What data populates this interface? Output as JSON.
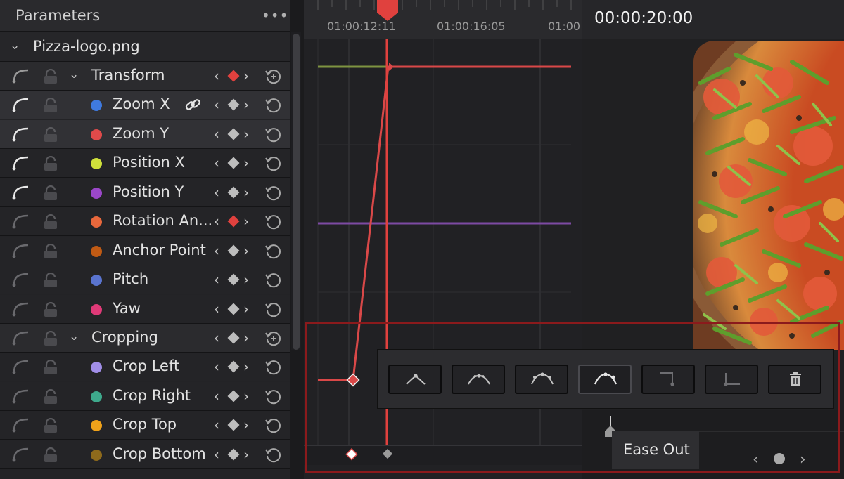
{
  "parameters_panel": {
    "title": "Parameters",
    "more_icon": "•••",
    "clip": {
      "name": "Pizza-logo.png"
    },
    "groups": [
      {
        "name": "Transform",
        "keyframe_color": "#e0413e",
        "rows": [
          {
            "label": "Zoom X",
            "dot": "#3f7ae0",
            "kf": "#bdbdbd",
            "link_icon": true,
            "selected": true
          },
          {
            "label": "Zoom Y",
            "dot": "#e04a4a",
            "kf": "#bdbdbd",
            "selected": true
          },
          {
            "label": "Position X",
            "dot": "#cfe03b",
            "kf": "#bdbdbd"
          },
          {
            "label": "Position Y",
            "dot": "#9b47c9",
            "kf": "#bdbdbd"
          },
          {
            "label": "Rotation An...",
            "dot": "#e8683c",
            "kf": "#e0413e"
          },
          {
            "label": "Anchor Point",
            "dot": "#c05a14",
            "kf": "#bdbdbd"
          },
          {
            "label": "Pitch",
            "dot": "#5a74cf",
            "kf": "#bdbdbd"
          },
          {
            "label": "Yaw",
            "dot": "#e03a78",
            "kf": "#bdbdbd"
          }
        ]
      },
      {
        "name": "Cropping",
        "keyframe_color": "#bdbdbd",
        "rows": [
          {
            "label": "Crop Left",
            "dot": "#a18ee8",
            "kf": "#bdbdbd"
          },
          {
            "label": "Crop Right",
            "dot": "#3ea98c",
            "kf": "#bdbdbd"
          },
          {
            "label": "Crop Top",
            "dot": "#f0a21a",
            "kf": "#bdbdbd"
          },
          {
            "label": "Crop Bottom",
            "dot": "#8e6a1c",
            "kf": "#bdbdbd"
          }
        ]
      }
    ]
  },
  "curve_editor": {
    "ruler_labels": [
      "01:00:12:11",
      "01:00:16:05",
      "01:00"
    ]
  },
  "viewer": {
    "timecode": "00:00:20:00"
  },
  "keyframe_toolbar": {
    "buttons": [
      "linear-icon",
      "ease-in-icon",
      "ease-in-out-icon",
      "ease-out-icon",
      "step-in-icon",
      "step-out-icon",
      "trash-icon"
    ],
    "tooltip": "Ease Out"
  },
  "colors": {
    "playhead": "#e0413e",
    "accent_red": "#d94848",
    "highlight_box": "#8b1a1c"
  }
}
